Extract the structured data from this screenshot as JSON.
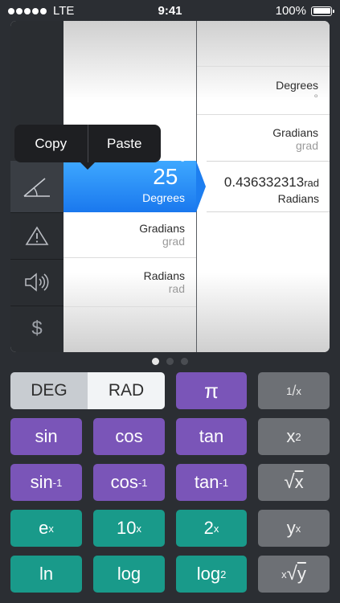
{
  "status": {
    "carrier": "LTE",
    "time": "9:41",
    "battery": "100%"
  },
  "popover": {
    "copy": "Copy",
    "paste": "Paste"
  },
  "left_col": {
    "rows": [
      {
        "name": "Gradians",
        "unit": "grad"
      },
      {
        "name": "Radians",
        "unit": "rad"
      }
    ],
    "selected": {
      "value": "25",
      "unit": "°",
      "label": "Degrees"
    }
  },
  "right_col": {
    "rows_above": [
      {
        "name": "Degrees",
        "unit": "°"
      },
      {
        "name": "Gradians",
        "unit": "grad"
      }
    ],
    "selected": {
      "value": "0.436332313",
      "unit": "rad",
      "label": "Radians"
    }
  },
  "sidebar": {
    "icons": [
      "angle-icon",
      "warning-icon",
      "speaker-icon",
      "dollar-icon"
    ],
    "dollar": "$"
  },
  "pages": {
    "count": 3,
    "current": 1
  },
  "keypad": {
    "mode": {
      "deg": "DEG",
      "rad": "RAD",
      "selected": "RAD"
    },
    "pi": "π",
    "reciprocal": {
      "num": "1",
      "den": "x"
    },
    "sin": "sin",
    "cos": "cos",
    "tan": "tan",
    "x2": {
      "base": "x",
      "exp": "2"
    },
    "asin": {
      "base": "sin",
      "exp": "-1"
    },
    "acos": {
      "base": "cos",
      "exp": "-1"
    },
    "atan": {
      "base": "tan",
      "exp": "-1"
    },
    "sqrt": {
      "sym": "√",
      "arg": "x"
    },
    "ex": {
      "base": "e",
      "exp": "x"
    },
    "tenx": {
      "base": "10",
      "exp": "x"
    },
    "twox": {
      "base": "2",
      "exp": "x"
    },
    "yx": {
      "base": "y",
      "exp": "x"
    },
    "ln": "ln",
    "log": "log",
    "log2": {
      "base": "log",
      "sub": "2"
    },
    "xrooty": {
      "idx": "x",
      "sym": "√",
      "arg": "y"
    }
  },
  "colors": {
    "purple": "#7a55b8",
    "teal": "#199a8a",
    "grey": "#6d7075",
    "accent_blue": "#1a78ee"
  }
}
